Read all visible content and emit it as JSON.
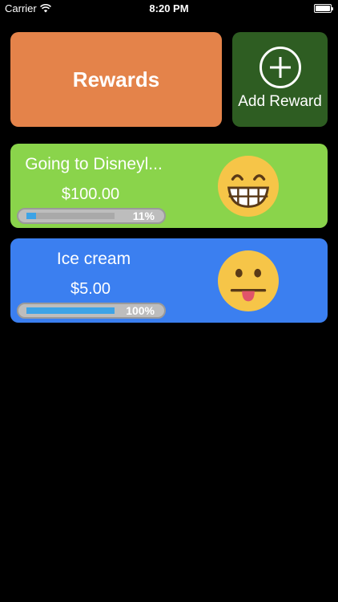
{
  "status_bar": {
    "carrier": "Carrier",
    "time": "8:20 PM",
    "wifi_icon": "wifi-icon",
    "battery_icon": "battery-icon"
  },
  "header": {
    "rewards_label": "Rewards",
    "add_reward_label": "Add Reward",
    "add_icon": "plus-circle-icon"
  },
  "rewards": [
    {
      "title": "Going to Disneyl...",
      "amount": "$100.00",
      "progress_label": "11%",
      "progress": 0.11,
      "emoji": "grinning-face-icon",
      "color": "#8ad44b"
    },
    {
      "title": "Ice cream",
      "amount": "$5.00",
      "progress_label": "100%",
      "progress": 1.0,
      "emoji": "tongue-out-face-icon",
      "color": "#3b7ff0"
    }
  ],
  "colors": {
    "background": "#000000",
    "rewards_button": "#e4834a",
    "add_reward_button": "#2e5d22",
    "progress_fill": "#3da3e6",
    "emoji_yellow": "#f6c548"
  }
}
